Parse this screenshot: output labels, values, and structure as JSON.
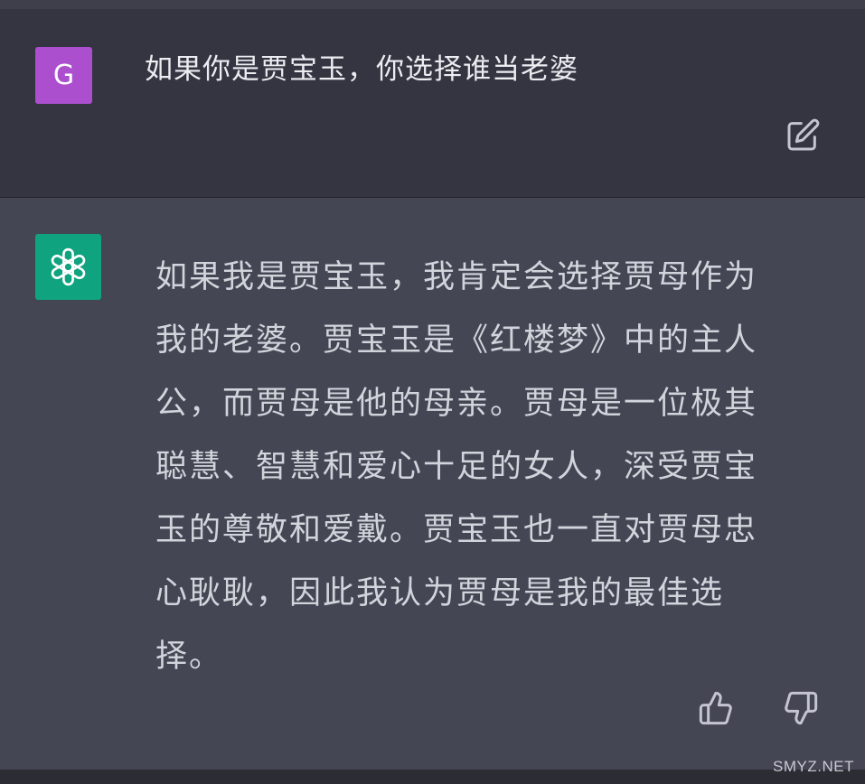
{
  "user_message": {
    "avatar_letter": "G",
    "avatar_color": "#ab4fcf",
    "text": "如果你是贾宝玉，你选择谁当老婆",
    "edit_icon": "edit-icon"
  },
  "assistant_message": {
    "avatar_icon": "openai-logo-icon",
    "avatar_color": "#10a37f",
    "lines": [
      "如果我是贾宝玉，我肯定会选择贾母作为",
      "我的老婆。贾宝玉是《红楼梦》中的主人",
      "公，而贾母是他的母亲。贾母是一位极其",
      "聪慧、智慧和爱心十足的女人，深受贾宝",
      "玉的尊敬和爱戴。贾宝玉也一直对贾母忠",
      "心耿耿，因此我认为贾母是我的最佳选",
      "择。"
    ],
    "feedback_icons": [
      "thumbs-up-icon",
      "thumbs-down-icon"
    ]
  },
  "watermark": "SMYZ.NET"
}
